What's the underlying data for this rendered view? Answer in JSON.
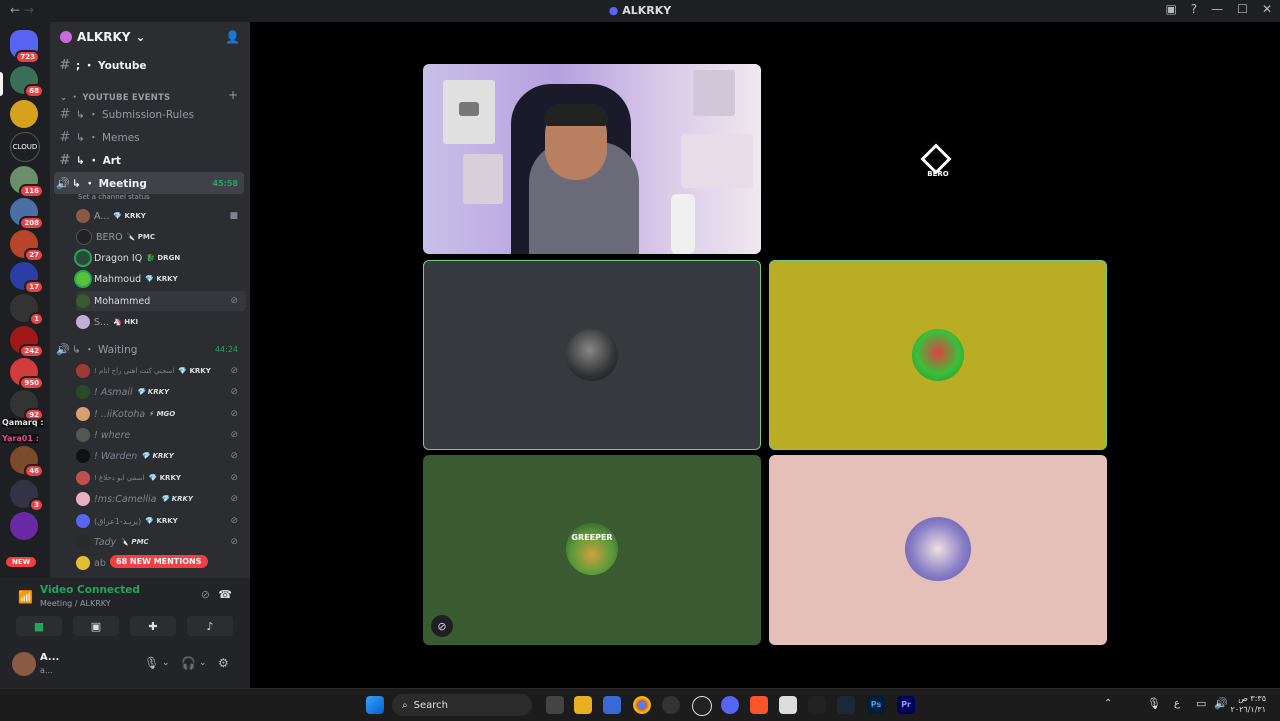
{
  "window": {
    "title": "ALKRKY",
    "back": "←",
    "forward": "→"
  },
  "guilds": {
    "badges": [
      "723",
      "68",
      "116",
      "208",
      "27",
      "17",
      "1",
      "242",
      "950",
      "92",
      "46",
      "3"
    ],
    "new_label": "NEW",
    "overlay_text": [
      "Qamarq :",
      "Yara01 :"
    ]
  },
  "server": {
    "name": "ALKRKY"
  },
  "channels": [
    {
      "prefix": "#",
      "label": "; ・ Youtube",
      "bold": true
    },
    {
      "prefix": "#",
      "label": "↳ ・ Submission-Rules",
      "bold": false
    },
    {
      "prefix": "#",
      "label": "↳ ・ Memes",
      "bold": false
    },
    {
      "prefix": "#",
      "label": "↳ ・ Art",
      "bold": true
    }
  ],
  "category": {
    "label": "・ YOUTUBE EVENTS"
  },
  "meeting": {
    "label": "↳ ・ Meeting",
    "timer": "45:58",
    "status": "Set a channel status"
  },
  "meeting_members": [
    {
      "name": "A...",
      "tag": "💎 KRKY"
    },
    {
      "name": "BERO",
      "tag": "🔪 PMC"
    },
    {
      "name": "Dragon IQ",
      "tag": "🐉 DRGN"
    },
    {
      "name": "Mahmoud",
      "tag": "💎 KRKY"
    },
    {
      "name": "Mohammed",
      "tag": ""
    },
    {
      "name": "S...",
      "tag": "🦄 HKI"
    }
  ],
  "waiting": {
    "label": "↳ ・ Waiting",
    "timer": "44:24"
  },
  "waiting_members": [
    {
      "name": "! اسجني كنت اهني راح انام",
      "tag": "💎 KRKY"
    },
    {
      "name": "! Asmail",
      "tag": "💎 KRKY"
    },
    {
      "name": "! ..iiKotoha",
      "tag": "⚡ MGO"
    },
    {
      "name": "! where",
      "tag": ""
    },
    {
      "name": "! Warden",
      "tag": "💎 KRKY"
    },
    {
      "name": "! اسمي ابو دحلاغ",
      "tag": "💎 KRKY"
    },
    {
      "name": "!ms:Camellia",
      "tag": "💎 KRKY"
    },
    {
      "name": "(يريـد-1عراق)",
      "tag": "💎 KRKY"
    },
    {
      "name": "Tady",
      "tag": "🔪 PMC"
    },
    {
      "name": "ab",
      "tag": ""
    }
  ],
  "mentions": "68 NEW MENTIONS",
  "rtc": {
    "status": "Video Connected",
    "channel": "Meeting / ALKRKY"
  },
  "user": {
    "name": "A...",
    "status": "a..."
  },
  "stage": {
    "bero_label": "BERO",
    "greeper_text": "GREEPER"
  },
  "taskbar": {
    "search": "Search",
    "time": "٣:٣٥ ص",
    "date": "٢٠٢٦/١/٣١",
    "lang": "ع"
  },
  "colors": {
    "tile_gray": "#363a3f",
    "tile_olive": "#b8ad25",
    "tile_green": "#3a5a32",
    "tile_pink": "#e5c0b8",
    "speaking": "#23a55a"
  }
}
